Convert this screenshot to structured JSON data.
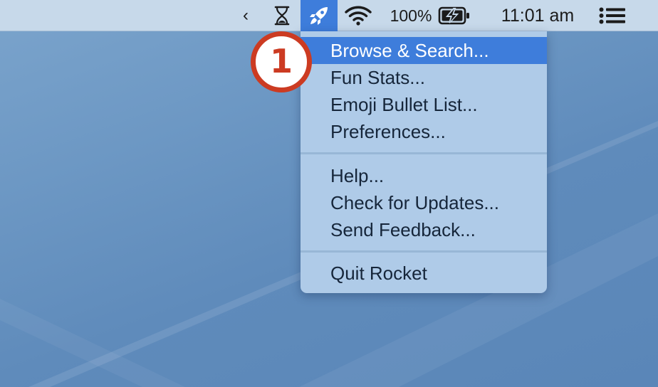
{
  "menubar": {
    "chevron": "‹",
    "battery_percent": "100%",
    "clock": "11:01 am",
    "icons": {
      "chevron": "chevron-left-icon",
      "hourglass": "hourglass-icon",
      "rocket": "rocket-icon",
      "wifi": "wifi-icon",
      "battery": "battery-charging-icon",
      "list": "list-icon"
    }
  },
  "menu": {
    "groups": [
      [
        "Browse & Search...",
        "Fun Stats...",
        "Emoji Bullet List...",
        "Preferences..."
      ],
      [
        "Help...",
        "Check for Updates...",
        "Send Feedback..."
      ],
      [
        "Quit Rocket"
      ]
    ],
    "highlighted_item": "Browse & Search..."
  },
  "annotation": {
    "step_number": "1",
    "color": "#cc3b22"
  },
  "colors": {
    "highlight": "#3e7ddb",
    "menu_background": "#afcbe8",
    "menubar_background": "#c7d9ea"
  }
}
